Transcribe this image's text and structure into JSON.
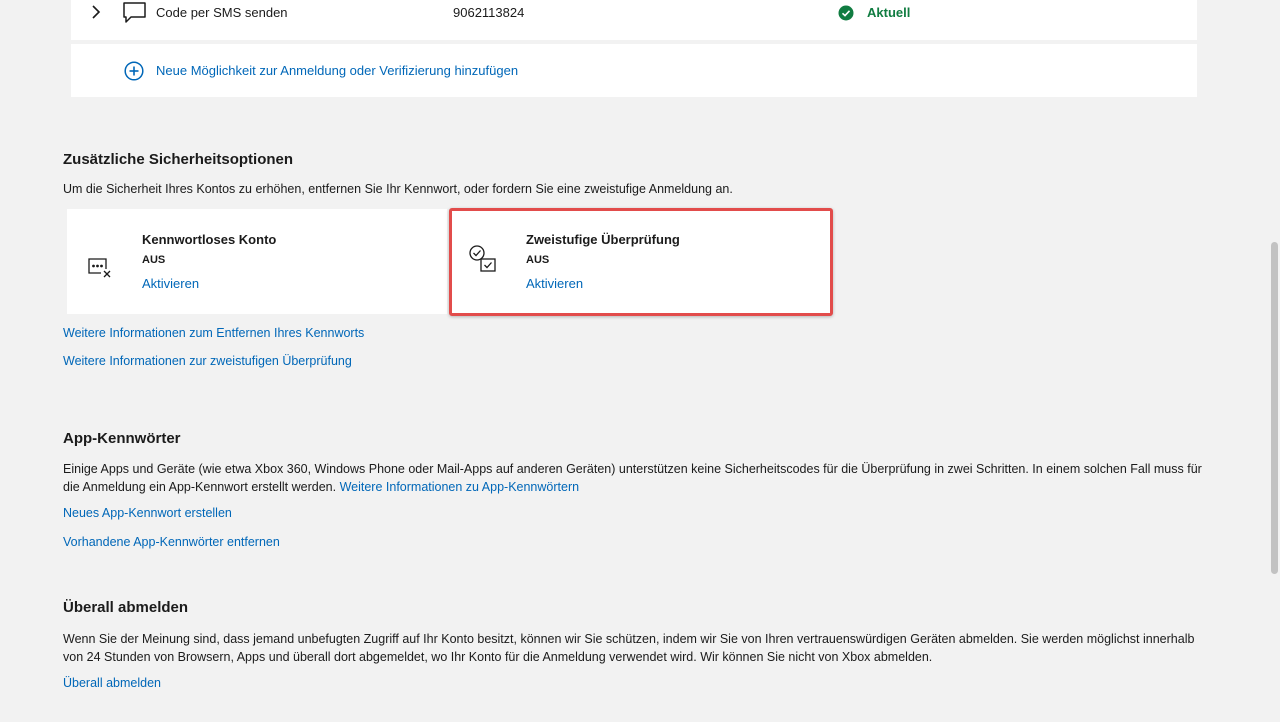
{
  "methods": {
    "sms": {
      "name": "Code per SMS senden",
      "value": "9062113824",
      "status": "Aktuell"
    },
    "add_label": "Neue Möglichkeit zur Anmeldung oder Verifizierung hinzufügen"
  },
  "security_options": {
    "title": "Zusätzliche Sicherheitsoptionen",
    "description": "Um die Sicherheit Ihres Kontos zu erhöhen, entfernen Sie Ihr Kennwort, oder fordern Sie eine zweistufige Anmeldung an.",
    "cards": [
      {
        "title": "Kennwortloses Konto",
        "status": "AUS",
        "action": "Aktivieren",
        "icon": "password-off-icon"
      },
      {
        "title": "Zweistufige Überprüfung",
        "status": "AUS",
        "action": "Aktivieren",
        "icon": "two-step-verification-icon"
      }
    ],
    "links": [
      "Weitere Informationen zum Entfernen Ihres Kennworts",
      "Weitere Informationen zur zweistufigen Überprüfung"
    ]
  },
  "app_passwords": {
    "title": "App-Kennwörter",
    "description": "Einige Apps und Geräte (wie etwa Xbox 360, Windows Phone oder Mail-Apps auf anderen Geräten) unterstützen keine Sicherheitscodes für die Überprüfung in zwei Schritten. In einem solchen Fall muss für die Anmeldung ein App-Kennwort erstellt werden.",
    "inline_link": "Weitere Informationen zu App-Kennwörtern",
    "create_link": "Neues App-Kennwort erstellen",
    "remove_link": "Vorhandene App-Kennwörter entfernen"
  },
  "sign_out_everywhere": {
    "title": "Überall abmelden",
    "description": "Wenn Sie der Meinung sind, dass jemand unbefugten Zugriff auf Ihr Konto besitzt, können wir Sie schützen, indem wir Sie von Ihren vertrauenswürdigen Geräten abmelden. Sie werden möglichst innerhalb von 24 Stunden von Browsern, Apps und überall dort abgemeldet, wo Ihr Konto für die Anmeldung verwendet wird. Wir können Sie nicht von Xbox abmelden.",
    "link": "Überall abmelden"
  },
  "colors": {
    "link": "#0067b8",
    "success": "#107c41",
    "highlight": "#e24c4b",
    "background": "#f2f2f2"
  }
}
